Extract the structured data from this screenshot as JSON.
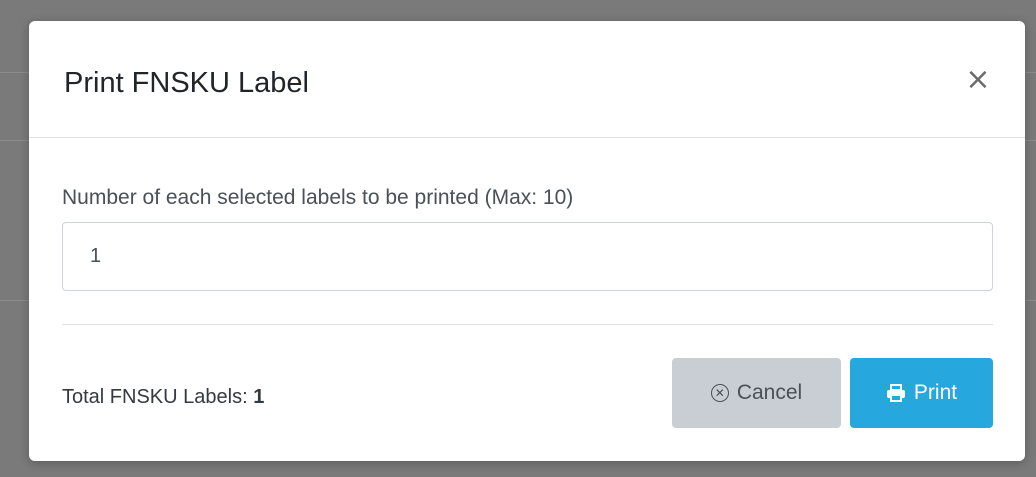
{
  "modal": {
    "title": "Print FNSKU Label",
    "close_symbol": "×",
    "close_icon": "close-icon"
  },
  "form": {
    "label": "Number of each selected labels to be printed (Max: 10)",
    "quantity_value": "1"
  },
  "footer": {
    "total_label": "Total FNSKU Labels: ",
    "total_value": "1",
    "cancel_label": "Cancel",
    "cancel_icon": "circle-x-icon",
    "print_label": "Print",
    "print_icon": "printer-icon"
  },
  "colors": {
    "print_button": "#26a7de",
    "cancel_button": "#c9ced4",
    "backdrop": "#7a7a7a"
  }
}
